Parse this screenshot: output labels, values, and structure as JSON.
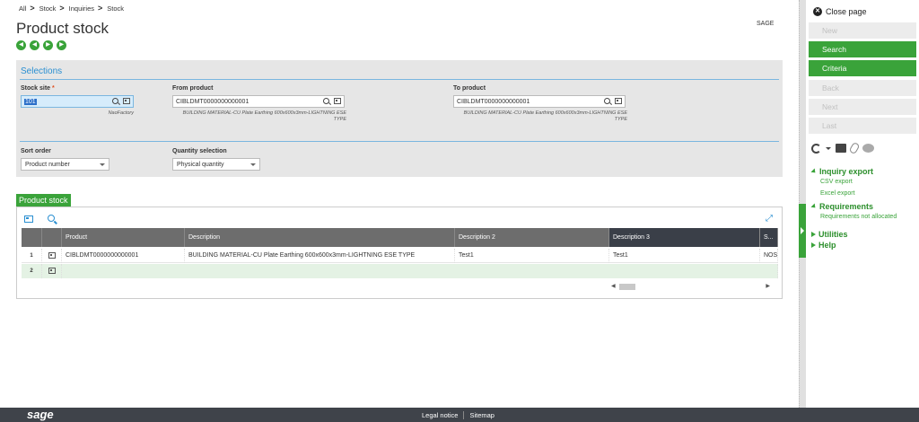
{
  "breadcrumb": {
    "items": [
      "All",
      "Stock",
      "Inquiries",
      "Stock"
    ],
    "sep": ">"
  },
  "page": {
    "title": "Product stock",
    "sage_label": "SAGE"
  },
  "selections": {
    "title": "Selections",
    "stock_site": {
      "label": "Stock site",
      "required": "*",
      "value": "101",
      "hint": "NaoFactory"
    },
    "from_product": {
      "label": "From product",
      "value": "CIBLDMT0000000000001",
      "hint": "BUILDING MATERIAL-CU Plate Earthing 600x600x3mm-LIGHTNING ESE TYPE"
    },
    "to_product": {
      "label": "To product",
      "value": "CIBLDMT0000000000001",
      "hint": "BUILDING MATERIAL-CU Plate Earthing 600x600x3mm-LIGHTNING ESE TYPE"
    },
    "sort_order": {
      "label": "Sort order",
      "value": "Product number"
    },
    "quantity_selection": {
      "label": "Quantity selection",
      "value": "Physical quantity"
    }
  },
  "product_stock": {
    "tab_label": "Product stock",
    "columns": [
      "Product",
      "Description",
      "Description 2",
      "Description 3",
      "S..."
    ],
    "rows": [
      {
        "num": "1",
        "product": "CIBLDMT0000000000001",
        "description": "BUILDING MATERIAL-CU Plate Earthing 600x600x3mm-LIGHTNING ESE TYPE",
        "description2": "Test1",
        "description3": "Test1",
        "s": "NOS"
      },
      {
        "num": "2",
        "product": "",
        "description": "",
        "description2": "",
        "description3": "",
        "s": ""
      }
    ]
  },
  "right_panel": {
    "close_label": "Close page",
    "buttons": {
      "new": "New",
      "search": "Search",
      "criteria": "Criteria",
      "back": "Back",
      "next": "Next",
      "last": "Last"
    },
    "inquiry_export": {
      "title": "Inquiry export",
      "csv": "CSV export",
      "excel": "Excel export"
    },
    "requirements": {
      "title": "Requirements",
      "not_allocated": "Requirements not allocated"
    },
    "utilities": "Utilities",
    "help": "Help"
  },
  "footer": {
    "logo": "sage",
    "legal": "Legal notice",
    "sitemap": "Sitemap"
  },
  "colors": {
    "accent_green": "#3aa33a",
    "accent_blue": "#2a8fd1",
    "footer_bg": "#3f434a"
  }
}
